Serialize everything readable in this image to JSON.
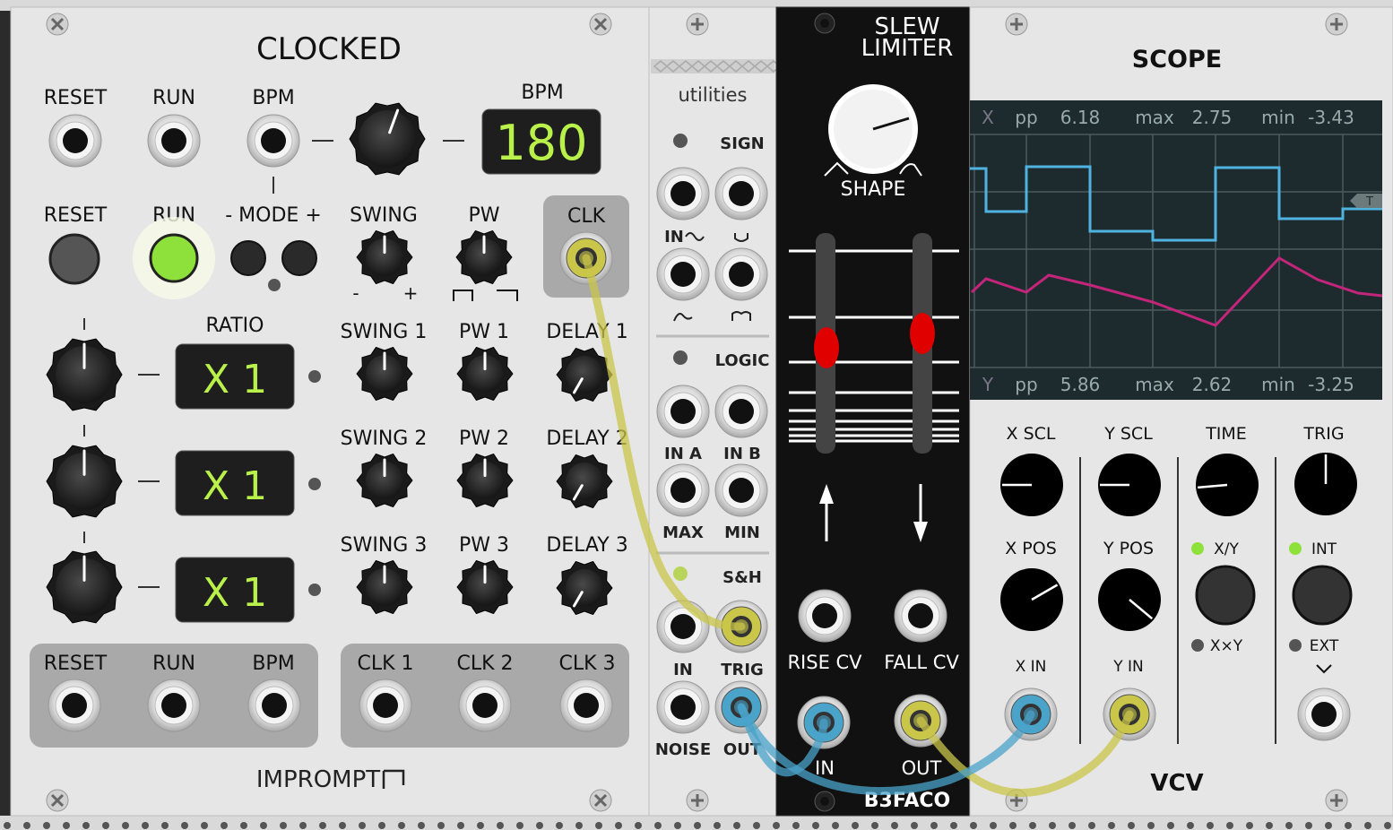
{
  "clocked": {
    "title": "CLOCKED",
    "brand": "IMPROMPT",
    "reset_label": "RESET",
    "run_label": "RUN",
    "bpm_label": "BPM",
    "bpm_display_label": "BPM",
    "bpm_value": "180",
    "mode_label": "- MODE +",
    "swing_label": "SWING",
    "pw_label": "PW",
    "clk_label": "CLK",
    "minus": "-",
    "plus": "+",
    "ratio_label": "RATIO",
    "ratio_values": [
      "X 1",
      "X 1",
      "X 1"
    ],
    "swing_labels": [
      "SWING 1",
      "SWING 2",
      "SWING 3"
    ],
    "pw_labels": [
      "PW 1",
      "PW 2",
      "PW 3"
    ],
    "delay_labels": [
      "DELAY 1",
      "DELAY 2",
      "DELAY 3"
    ],
    "out_labels": [
      "RESET",
      "RUN",
      "BPM"
    ],
    "clk_out_labels": [
      "CLK 1",
      "CLK 2",
      "CLK 3"
    ]
  },
  "utilities": {
    "title": "utilities",
    "sign_label": "SIGN",
    "in_label": "IN",
    "logic_label": "LOGIC",
    "in_a_label": "IN A",
    "in_b_label": "IN B",
    "max_label": "MAX",
    "min_label": "MIN",
    "sh_label": "S&H",
    "in2_label": "IN",
    "trig_label": "TRIG",
    "noise_label": "NOISE",
    "out_label": "OUT"
  },
  "slew": {
    "title_line1": "SLEW",
    "title_line2": "LIMITER",
    "shape_label": "SHAPE",
    "rise_cv_label": "RISE CV",
    "fall_cv_label": "FALL CV",
    "in_label": "IN",
    "out_label": "OUT",
    "brand": "B3FACO"
  },
  "scope": {
    "title": "SCOPE",
    "x_stats": {
      "channel": "X",
      "pp_label": "pp",
      "pp": "6.18",
      "max_label": "max",
      "max": "2.75",
      "min_label": "min",
      "min": "-3.43"
    },
    "y_stats": {
      "channel": "Y",
      "pp_label": "pp",
      "pp": "5.86",
      "max_label": "max",
      "max": "2.62",
      "min_label": "min",
      "min": "-3.25"
    },
    "trig_marker": "T",
    "x_scl_label": "X SCL",
    "y_scl_label": "Y SCL",
    "time_label": "TIME",
    "trig_label": "TRIG",
    "x_pos_label": "X POS",
    "y_pos_label": "Y POS",
    "xy_label": "X/Y",
    "xxy_label": "X×Y",
    "int_label": "INT",
    "ext_label": "EXT",
    "x_in_label": "X IN",
    "y_in_label": "Y IN",
    "brand": "VCV",
    "x_color": "#4fb3e0",
    "y_color": "#c2257a"
  },
  "colors": {
    "cable_yellow": "#c9c64a",
    "cable_blue": "#4aa3c9",
    "led_green": "#8ee03a",
    "slider_red": "#e00000"
  }
}
